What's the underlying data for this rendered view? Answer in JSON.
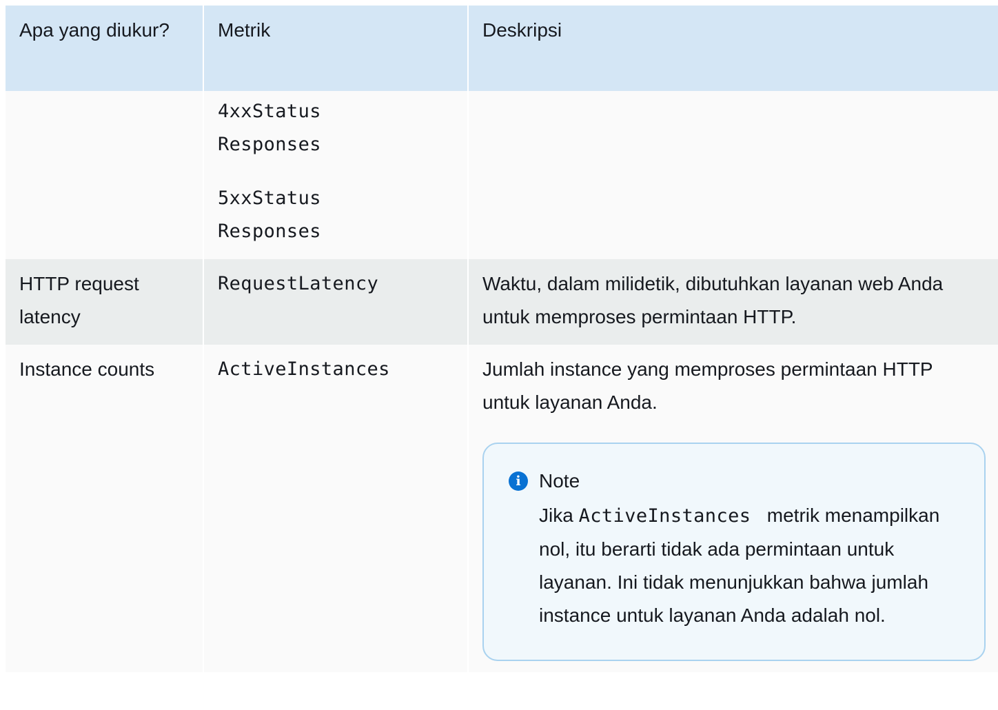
{
  "headers": {
    "what": "Apa yang diukur?",
    "metric": "Metrik",
    "description": "Deskripsi"
  },
  "continued_row": {
    "metrics": [
      [
        "4xxStatus",
        "Responses"
      ],
      [
        "5xxStatus",
        "Responses"
      ]
    ]
  },
  "rows": [
    {
      "what": "HTTP request latency",
      "metric": "RequestLatency",
      "description": "Waktu, dalam milidetik, dibutuhkan layanan web Anda untuk memproses permintaan HTTP."
    },
    {
      "what": "Instance counts",
      "metric": "ActiveInstances",
      "description": "Jumlah instance yang memproses permintaan HTTP untuk layanan Anda."
    }
  ],
  "note": {
    "icon": "info-icon",
    "title": "Note",
    "lead": "Jika",
    "code": "ActiveInstances",
    "body": "metrik menampilkan nol, itu berarti tidak ada permintaan untuk layanan. Ini tidak menunjukkan bahwa jumlah instance untuk layanan Anda adalah nol."
  },
  "colors": {
    "header_bg": "#d4e6f5",
    "row_light": "#fafafa",
    "row_gray": "#eaeded",
    "note_border": "#a9d2ef",
    "note_bg": "#f1f8fc",
    "icon_blue": "#0972d3"
  }
}
